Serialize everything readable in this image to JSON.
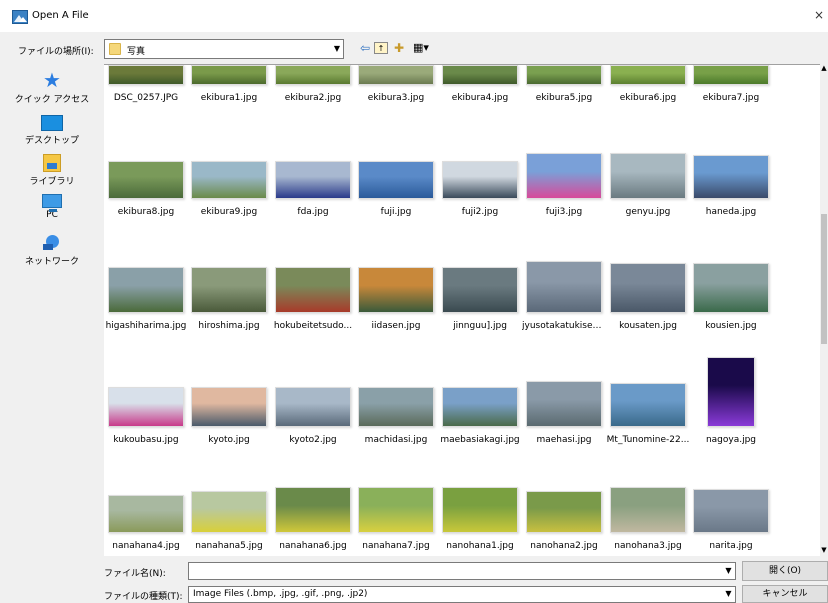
{
  "window": {
    "title": "Open A File",
    "close_glyph": "×"
  },
  "toolbar": {
    "look_in_label": "ファイルの場所(I):",
    "look_in_value": "写真",
    "icons": [
      "back-icon",
      "up-folder-icon",
      "new-folder-icon",
      "view-menu-icon"
    ]
  },
  "places": [
    {
      "label": "クイック アクセス",
      "icon": "quick-access-icon"
    },
    {
      "label": "デスクトップ",
      "icon": "desktop-icon"
    },
    {
      "label": "ライブラリ",
      "icon": "library-icon"
    },
    {
      "label": "PC",
      "icon": "pc-icon"
    },
    {
      "label": "ネットワーク",
      "icon": "network-icon"
    }
  ],
  "files": [
    {
      "name": "DSC_0257.JPG",
      "colors": [
        "#6b7a3a",
        "#3f5a2a"
      ]
    },
    {
      "name": "ekibura1.jpg",
      "colors": [
        "#7a9a4a",
        "#4c6a2c"
      ]
    },
    {
      "name": "ekibura2.jpg",
      "colors": [
        "#8aa85a",
        "#5a7a30"
      ]
    },
    {
      "name": "ekibura3.jpg",
      "colors": [
        "#9aaa7a",
        "#6a7a50"
      ]
    },
    {
      "name": "ekibura4.jpg",
      "colors": [
        "#6a8a4a",
        "#3f5a2a"
      ]
    },
    {
      "name": "ekibura5.jpg",
      "colors": [
        "#7aa050",
        "#4a6a30"
      ]
    },
    {
      "name": "ekibura6.jpg",
      "colors": [
        "#8ab050",
        "#5c8030"
      ]
    },
    {
      "name": "ekibura7.jpg",
      "colors": [
        "#78a048",
        "#4c7a2a"
      ]
    },
    {
      "name": "ekibura8.jpg",
      "colors": [
        "#7a9a5a",
        "#4a6a3a"
      ]
    },
    {
      "name": "ekibura9.jpg",
      "colors": [
        "#9ab8c8",
        "#6a8a4a"
      ]
    },
    {
      "name": "fda.jpg",
      "colors": [
        "#a8b8d0",
        "#2a3a8a"
      ]
    },
    {
      "name": "fuji.jpg",
      "colors": [
        "#5a8ac8",
        "#2a5a9a"
      ]
    },
    {
      "name": "fuji2.jpg",
      "colors": [
        "#d0d8e0",
        "#3a4a5a"
      ]
    },
    {
      "name": "fuji3.jpg",
      "colors": [
        "#7aa0d8",
        "#d84a9a"
      ]
    },
    {
      "name": "genyu.jpg",
      "colors": [
        "#a8b8c0",
        "#6a7a80"
      ]
    },
    {
      "name": "haneda.jpg",
      "colors": [
        "#6a9ad0",
        "#3a4a6a"
      ]
    },
    {
      "name": "higashiharima.jpg",
      "colors": [
        "#8aa0a8",
        "#4a6a3a"
      ]
    },
    {
      "name": "hiroshima.jpg",
      "colors": [
        "#8a9a7a",
        "#4a5a3a"
      ]
    },
    {
      "name": "hokubeitetsudo...",
      "colors": [
        "#7a8a5a",
        "#a83a2a"
      ]
    },
    {
      "name": "iidasen.jpg",
      "colors": [
        "#c8883a",
        "#3a5a3a"
      ]
    },
    {
      "name": "jinnguu].jpg",
      "colors": [
        "#6a7a80",
        "#3a4a50"
      ]
    },
    {
      "name": "jyusotakatukisen....",
      "colors": [
        "#8a98a8",
        "#5a6878"
      ]
    },
    {
      "name": "kousaten.jpg",
      "colors": [
        "#7a8898",
        "#4a5868"
      ]
    },
    {
      "name": "kousien.jpg",
      "colors": [
        "#8aa0a0",
        "#3a6a4a"
      ]
    },
    {
      "name": "kukoubasu.jpg",
      "colors": [
        "#d8e0ea",
        "#c83a8a"
      ]
    },
    {
      "name": "kyoto.jpg",
      "colors": [
        "#e0b8a0",
        "#4a5a6a"
      ]
    },
    {
      "name": "kyoto2.jpg",
      "colors": [
        "#a8b8c8",
        "#5a6a7a"
      ]
    },
    {
      "name": "machidasi.jpg",
      "colors": [
        "#8aa0a8",
        "#5a6a5a"
      ]
    },
    {
      "name": "maebasiakagi.jpg",
      "colors": [
        "#7aa0c8",
        "#4a6a4a"
      ]
    },
    {
      "name": "maehasi.jpg",
      "colors": [
        "#8a9aa8",
        "#5a6a70"
      ]
    },
    {
      "name": "Mt_Tunomine-22...",
      "colors": [
        "#6a9ac8",
        "#3a6a8a"
      ]
    },
    {
      "name": "nagoya.jpg",
      "colors": [
        "#1a0a4a",
        "#8a3ad8"
      ]
    },
    {
      "name": "nanahana4.jpg",
      "colors": [
        "#a8b8a0",
        "#8a9a5a"
      ]
    },
    {
      "name": "nanahana5.jpg",
      "colors": [
        "#b8c8a0",
        "#d8d03a"
      ]
    },
    {
      "name": "nanahana6.jpg",
      "colors": [
        "#6a8a4a",
        "#d0c83a"
      ]
    },
    {
      "name": "nanahana7.jpg",
      "colors": [
        "#8ab05a",
        "#d8d040"
      ]
    },
    {
      "name": "nanohana1.jpg",
      "colors": [
        "#7aa040",
        "#c8c83a"
      ]
    },
    {
      "name": "nanohana2.jpg",
      "colors": [
        "#7a9a4a",
        "#c8c040"
      ]
    },
    {
      "name": "nanohana3.jpg",
      "colors": [
        "#8aa080",
        "#c0b8a0"
      ]
    },
    {
      "name": "narita.jpg",
      "colors": [
        "#8a98a8",
        "#6a7888"
      ]
    }
  ],
  "bottom": {
    "filename_label": "ファイル名(N):",
    "filename_value": "",
    "open_button": "開く(O)",
    "filetype_label": "ファイルの種類(T):",
    "filetype_value": "Image Files (.bmp, .jpg, .gif, .png, .jp2)",
    "cancel_button": "キャンセル"
  }
}
